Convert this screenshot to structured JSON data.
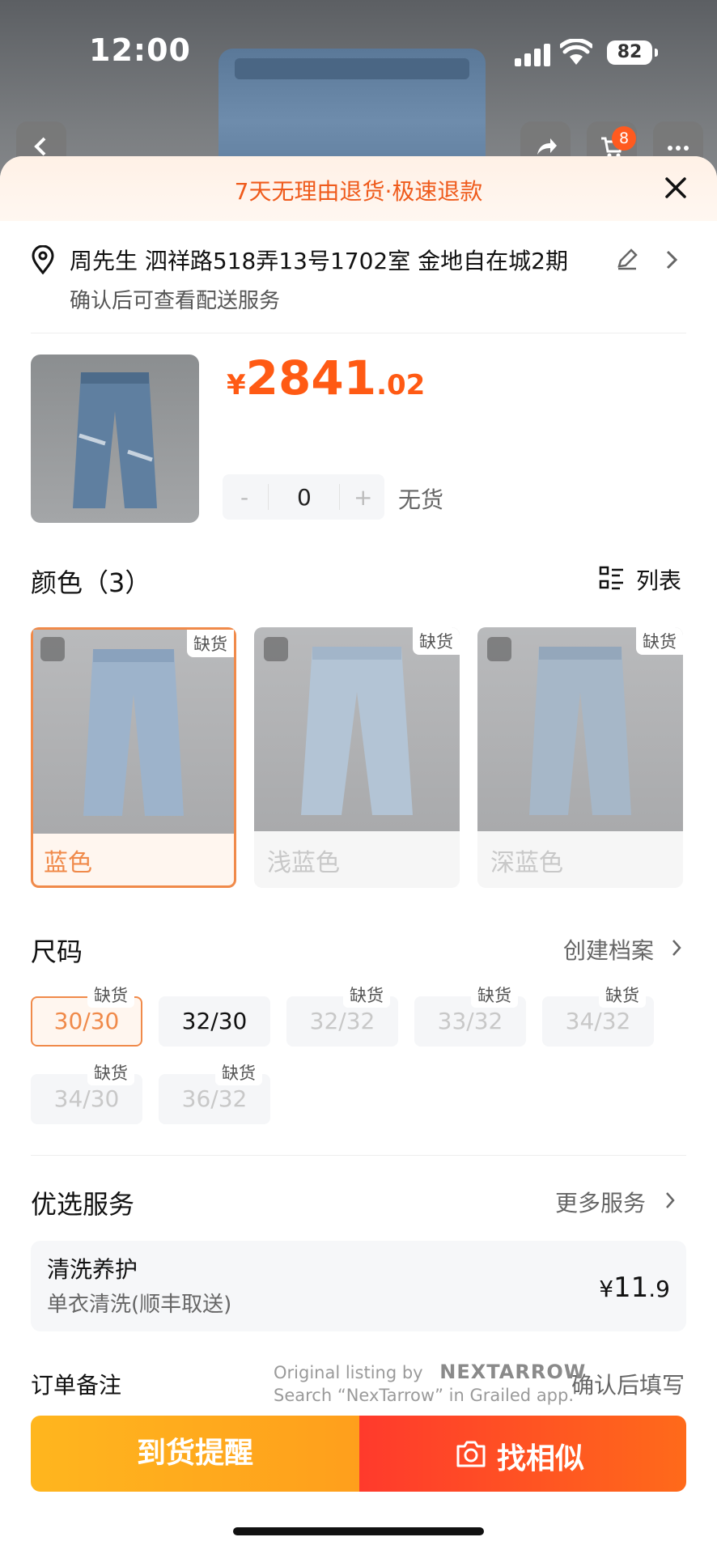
{
  "status_bar": {
    "time": "12:00",
    "battery": "82"
  },
  "header": {
    "cart_badge": "8"
  },
  "banner": {
    "text": "7天无理由退货·极速退款"
  },
  "address": {
    "main": "周先生 泗祥路518弄13号1702室 金地自在城2期",
    "sub": "确认后可查看配送服务"
  },
  "product": {
    "currency": "¥",
    "price_int": "2841",
    "price_dec": ".02",
    "quantity": "0",
    "minus": "-",
    "plus": "+",
    "stock_status": "无货"
  },
  "colors": {
    "title": "颜色（3）",
    "view_mode": "列表",
    "items": [
      {
        "label": "蓝色",
        "tag": "缺货",
        "selected": true
      },
      {
        "label": "浅蓝色",
        "tag": "缺货",
        "selected": false
      },
      {
        "label": "深蓝色",
        "tag": "缺货",
        "selected": false
      }
    ]
  },
  "sizes": {
    "title": "尺码",
    "profile_link": "创建档案",
    "items": [
      {
        "label": "30/30",
        "tag": "缺货",
        "selected": true
      },
      {
        "label": "32/30",
        "tag": "",
        "selected": false
      },
      {
        "label": "32/32",
        "tag": "缺货",
        "selected": false
      },
      {
        "label": "33/32",
        "tag": "缺货",
        "selected": false
      },
      {
        "label": "34/32",
        "tag": "缺货",
        "selected": false
      },
      {
        "label": "34/30",
        "tag": "缺货",
        "selected": false
      },
      {
        "label": "36/32",
        "tag": "缺货",
        "selected": false
      }
    ]
  },
  "services": {
    "title": "优选服务",
    "more": "更多服务",
    "item": {
      "title": "清洗养护",
      "sub": "单衣清洗(顺丰取送)",
      "currency": "¥",
      "price_int": "11",
      "price_dec": ".9"
    }
  },
  "order_note": {
    "label": "订单备注",
    "value": "确认后填写"
  },
  "watermark": {
    "line1": "Original listing by",
    "brand": "NEXTARROW",
    "line2": "Search “NexTarrow” in Grailed app."
  },
  "actions": {
    "notify": "到货提醒",
    "find_similar": "找相似"
  },
  "colors_theme": {
    "accent": "#ff5a14",
    "selected_border": "#f08a4a"
  }
}
